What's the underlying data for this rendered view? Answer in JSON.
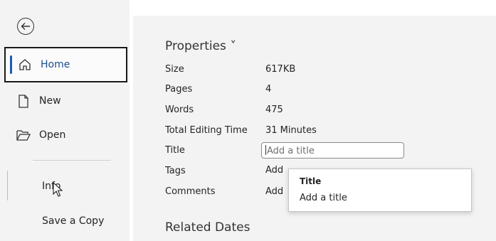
{
  "sidebar": {
    "items": [
      {
        "label": "Home",
        "icon": "home-icon",
        "selected": true
      },
      {
        "label": "New",
        "icon": "new-document-icon"
      },
      {
        "label": "Open",
        "icon": "open-folder-icon"
      },
      {
        "label": "Info"
      },
      {
        "label": "Save a Copy"
      }
    ]
  },
  "properties": {
    "title": "Properties ˅",
    "rows": [
      {
        "label": "Size",
        "value": "617KB"
      },
      {
        "label": "Pages",
        "value": "4"
      },
      {
        "label": "Words",
        "value": "475"
      },
      {
        "label": "Total Editing Time",
        "value": "31 Minutes"
      },
      {
        "label": "Title",
        "placeholder": "Add a title"
      },
      {
        "label": "Tags",
        "value": "Add"
      },
      {
        "label": "Comments",
        "value": "Add"
      }
    ]
  },
  "tooltip": {
    "heading": "Title",
    "body": "Add a title"
  },
  "related_dates": {
    "title": "Related Dates"
  },
  "colors": {
    "accent": "#185abd",
    "sidebar_bg": "#f3f3f3"
  }
}
